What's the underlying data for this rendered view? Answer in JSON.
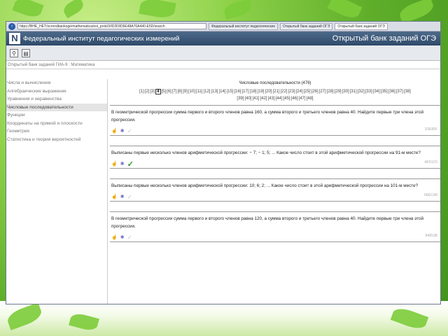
{
  "browser": {
    "address": "https://ВНЕ_НЕТ/ocrnndbankoge/mathematica/ext_prob/3/ID2F8D6E48A76A440-E5D/search",
    "tabs": [
      "Федеральный институт педагогических",
      "Открытый банк заданий ОГЭ",
      "Открытый банк заданий ОГЭ"
    ]
  },
  "header": {
    "institute": "Федеральный институт педагогических измерений",
    "bank": "Открытый банк заданий ОГЭ"
  },
  "breadcrumb": "Открытый банк заданий ГИА-9 : Математика",
  "sidebar": {
    "items": [
      "Числа и вычисления",
      "Алгебраические выражения",
      "Уравнения и неравенства",
      "Числовые последовательности",
      "Функции",
      "Координаты на прямой и плоскости",
      "Геометрия",
      "Статистика и теория вероятностей"
    ],
    "selected": 3
  },
  "main": {
    "title": "Числовые последовательности (476)",
    "pages_row1": [
      "[1]",
      "[2]",
      "[3]",
      "4",
      "[5]",
      "[6]",
      "[7]",
      "[8]",
      "[9]",
      "[10]",
      "[11]",
      "[12]",
      "[13]",
      "[14]",
      "[15]",
      "[16]",
      "[17]",
      "[18]",
      "[19]",
      "[20]",
      "[21]",
      "[22]",
      "[23]",
      "[24]",
      "[25]",
      "[26]",
      "[27]",
      "[28]",
      "[29]",
      "[30]",
      "[31]",
      "[32]",
      "[33]",
      "[34]",
      "[35]",
      "[36]",
      "[37]",
      "[38]"
    ],
    "pages_row2": [
      "[39]",
      "[40]",
      "[41]",
      "[42]",
      "[43]",
      "[44]",
      "[45]",
      "[46]",
      "[47]",
      "[48]"
    ],
    "tasks": [
      {
        "text": "В геометрической прогрессии сумма первого и второго членов равна 160, а сумма второго и третьего членов равна 40. Найдите первые три члена этой прогрессии.",
        "code": "1DE85F",
        "checked": false
      },
      {
        "text": "Выписаны первые несколько членов арифметической прогрессии: − 7; − 1; 5; ... Какое число стоит в этой арифметической прогрессии на 91-м месте?",
        "code": "AF61C0",
        "checked": true
      },
      {
        "text": "Выписаны первые несколько членов арифметической прогрессии: 10; 6; 2; ... Какое число стоит в этой арифметической прогрессии на 101-м месте?",
        "code": "9EECA8",
        "checked": false
      },
      {
        "text": "В геометрической прогрессии сумма первого и второго членов равна 120, а сумма второго и третьего членов равна 40. Найдите первые три члена этой прогрессии.",
        "code": "84853B",
        "checked": false
      }
    ]
  }
}
